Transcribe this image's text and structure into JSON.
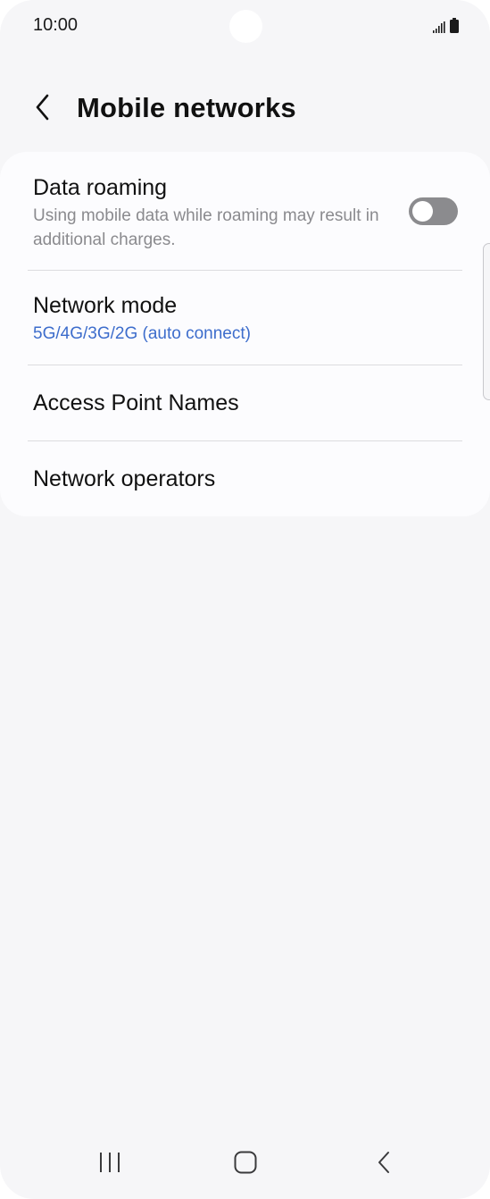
{
  "status_bar": {
    "time": "10:00",
    "icons": [
      "signal-icon",
      "battery-icon"
    ]
  },
  "header": {
    "back_icon": "chevron-left-icon",
    "title": "Mobile networks"
  },
  "settings": {
    "data_roaming": {
      "title": "Data roaming",
      "description": "Using mobile data while roaming may result in additional charges.",
      "enabled": false
    },
    "network_mode": {
      "title": "Network mode",
      "value": "5G/4G/3G/2G (auto connect)"
    },
    "access_point_names": {
      "title": "Access Point Names"
    },
    "network_operators": {
      "title": "Network operators"
    }
  },
  "nav_bar": {
    "items": [
      "recent-apps-icon",
      "home-icon",
      "back-icon"
    ]
  },
  "colors": {
    "background": "#f6f6f8",
    "card": "#fcfcfe",
    "accent": "#3d6dcc",
    "toggle_off": "#8b8b8e"
  }
}
